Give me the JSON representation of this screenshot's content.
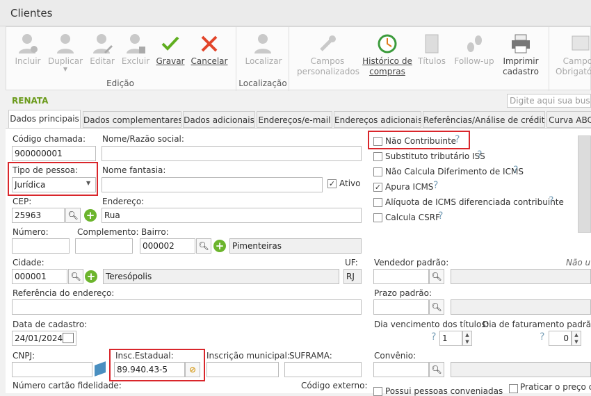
{
  "window": {
    "title": "Clientes"
  },
  "toolbar": {
    "buttons": [
      {
        "label": "Incluir",
        "icon": "user-add-icon"
      },
      {
        "label": "Duplicar",
        "icon": "user-duplicate-icon"
      },
      {
        "label": "Editar",
        "icon": "user-edit-icon"
      },
      {
        "label": "Excluir",
        "icon": "user-delete-icon"
      },
      {
        "label": "Gravar",
        "icon": "checkmark-icon"
      },
      {
        "label": "Cancelar",
        "icon": "cross-icon"
      },
      {
        "label": "Localizar",
        "icon": "user-search-icon"
      },
      {
        "label": "Campos personalizados",
        "icon": "tools-icon"
      },
      {
        "label": "Histórico de compras",
        "icon": "history-icon"
      },
      {
        "label": "Títulos",
        "icon": "documents-icon"
      },
      {
        "label": "Follow-up",
        "icon": "footsteps-icon"
      },
      {
        "label": "Imprimir cadastro",
        "icon": "printer-icon"
      },
      {
        "label": "Campos Obrigatórios",
        "icon": "form-icon"
      }
    ],
    "groups": {
      "edicao": "Edição",
      "localizacao": "Localização"
    }
  },
  "client_name": "RENATA",
  "search": {
    "placeholder": "Digite aqui sua busca..."
  },
  "tabs": [
    "Dados principais",
    "Dados complementares",
    "Dados adicionais",
    "Endereços/e-mail",
    "Endereços adicionais",
    "Referências/Análise de crédito",
    "Curva ABC"
  ],
  "form": {
    "codigo_label": "Código chamada:",
    "codigo": "900000001",
    "nome_label": "Nome/Razão social:",
    "nome": "",
    "tipo_label": "Tipo de pessoa:",
    "tipo": "Jurídica",
    "fantasia_label": "Nome fantasia:",
    "fantasia": "",
    "ativo_label": "Ativo",
    "ativo": true,
    "cep_label": "CEP:",
    "cep": "25963",
    "endereco_label": "Endereço:",
    "endereco": "Rua",
    "numero_label": "Número:",
    "numero": "",
    "complemento_label": "Complemento:",
    "complemento": "",
    "bairro_label": "Bairro:",
    "bairro_cod": "000002",
    "bairro_nome": "Pimenteiras",
    "cidade_label": "Cidade:",
    "cidade_cod": "000001",
    "cidade_nome": "Teresópolis",
    "uf_label": "UF:",
    "uf": "RJ",
    "referencia_label": "Referência do endereço:",
    "referencia": "",
    "data_label": "Data de cadastro:",
    "data": "24/01/2024",
    "cnpj_label": "CNPJ:",
    "cnpj": "",
    "insc_label": "Insc.Estadual:",
    "insc": "89.940.43-5",
    "municipal_label": "Inscrição municipal:",
    "municipal": "",
    "suframa_label": "SUFRAMA:",
    "suframa": "",
    "fidelidade_label": "Número cartão fidelidade:",
    "externo_label": "Código externo:"
  },
  "checks": [
    {
      "label": "Não Contribuinte",
      "checked": false
    },
    {
      "label": "Substituto tributário ISS",
      "checked": false
    },
    {
      "label": "Não Calcula Diferimento de ICMS",
      "checked": false
    },
    {
      "label": "Apura ICMS",
      "checked": true
    },
    {
      "label": "Alíquota de ICMS diferenciada contribuinte",
      "checked": false
    },
    {
      "label": "Calcula CSRF",
      "checked": false
    }
  ],
  "right": {
    "vendedor_label": "Vendedor padrão:",
    "nao_ut": "Não uti",
    "prazo_label": "Prazo padrão:",
    "vencimento_label": "Dia vencimento dos títulos:",
    "vencimento": "1",
    "faturamento_label": "Dia de faturamento padrão:",
    "faturamento": "0",
    "convenio_label": "Convênio:",
    "possui_label": "Possui pessoas conveniadas",
    "praticar_label": "Praticar o preço co"
  }
}
